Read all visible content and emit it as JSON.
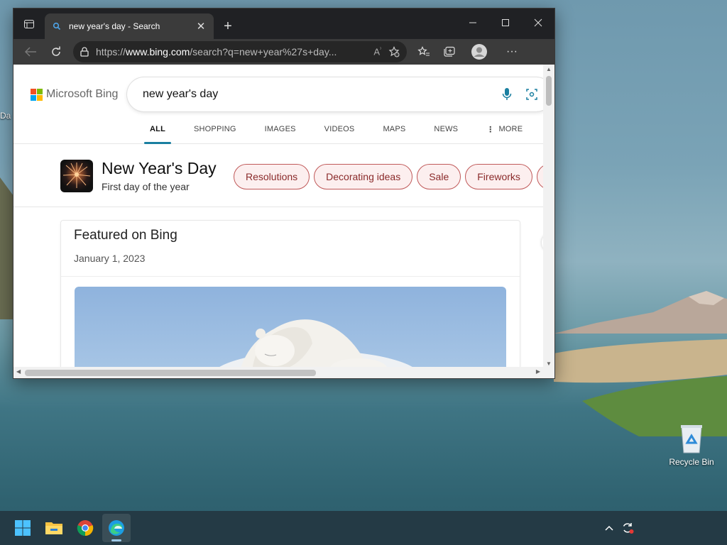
{
  "browser": {
    "tab_title": "new year's day - Search",
    "url_prefix": "https://",
    "url_domain": "www.bing.com",
    "url_rest": "/search?q=new+year%27s+day..."
  },
  "bing": {
    "logo_text": "Microsoft Bing",
    "query": "new year's day",
    "nav": [
      "ALL",
      "SHOPPING",
      "IMAGES",
      "VIDEOS",
      "MAPS",
      "NEWS",
      "MORE"
    ],
    "active_nav": "ALL"
  },
  "entity": {
    "title": "New Year's Day",
    "subtitle": "First day of the year",
    "chips": [
      "Resolutions",
      "Decorating ideas",
      "Sale",
      "Fireworks"
    ]
  },
  "card": {
    "title": "Featured on Bing",
    "date": "January 1, 2023"
  },
  "desktop": {
    "recycle_bin_label": "Recycle Bin",
    "partial_label": "Da"
  },
  "colors": {
    "accent": "#1a7fa0",
    "chip_border": "#c05a5a",
    "chip_text": "#8a2a2a"
  }
}
